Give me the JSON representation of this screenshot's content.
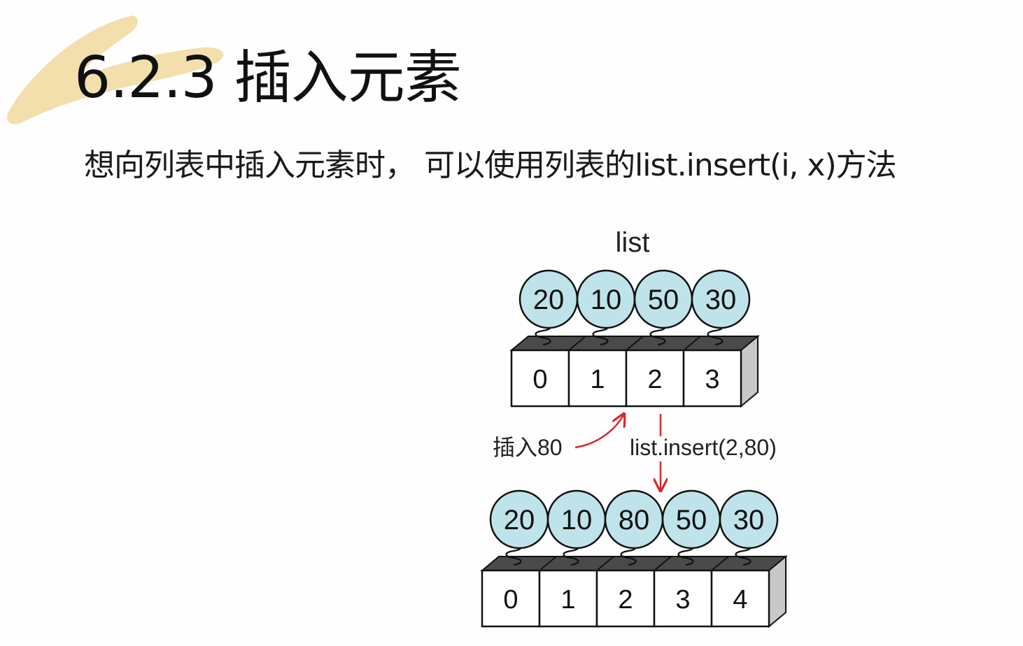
{
  "slide": {
    "title": "6.2.3 插入元素",
    "subtitle": "想向列表中插入元素时，  可以使用列表的list.insert(i, x)方法"
  },
  "diagram": {
    "list_label": "list",
    "before": {
      "values": [
        "20",
        "10",
        "50",
        "30"
      ],
      "indices": [
        "0",
        "1",
        "2",
        "3"
      ]
    },
    "insert_label": "插入80",
    "call_label": "list.insert(2,80)",
    "after": {
      "values": [
        "20",
        "10",
        "80",
        "50",
        "30"
      ],
      "indices": [
        "0",
        "1",
        "2",
        "3",
        "4"
      ]
    }
  },
  "colors": {
    "ball_fill": "#bfe3ea",
    "arrow": "#d42a2a",
    "brush": "#f2dca3"
  }
}
